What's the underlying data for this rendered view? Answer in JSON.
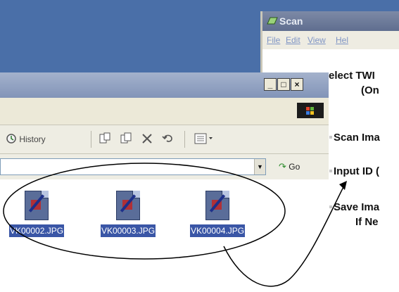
{
  "scan_window": {
    "title": "Scan",
    "menu": [
      "File",
      "Edit",
      "View",
      "Hel"
    ],
    "steps": [
      {
        "line1": "elect TWI",
        "line2": "(On"
      },
      {
        "line1": "Scan Ima"
      },
      {
        "line1": "Input ID ("
      },
      {
        "line1": "Save Ima",
        "line2": "If Ne"
      }
    ]
  },
  "explorer_window": {
    "buttons": {
      "minimize": "_",
      "maximize": "□",
      "close": "×"
    },
    "toolbar": {
      "history_label": "History"
    },
    "address": {
      "value": "",
      "go_label": "Go"
    },
    "files": [
      {
        "name": "VK00002.JPG"
      },
      {
        "name": "VK00003.JPG"
      },
      {
        "name": "VK00004.JPG"
      }
    ]
  },
  "colors": {
    "desktop": "#4a6fa8",
    "selection": "#3a56a6",
    "title_inactive": "#8294b8"
  },
  "icons": [
    "scan-app-icon",
    "windows-logo-icon",
    "history-icon",
    "move-to-icon",
    "copy-to-icon",
    "delete-icon",
    "undo-icon",
    "views-icon",
    "go-icon",
    "jpg-file-icon"
  ]
}
